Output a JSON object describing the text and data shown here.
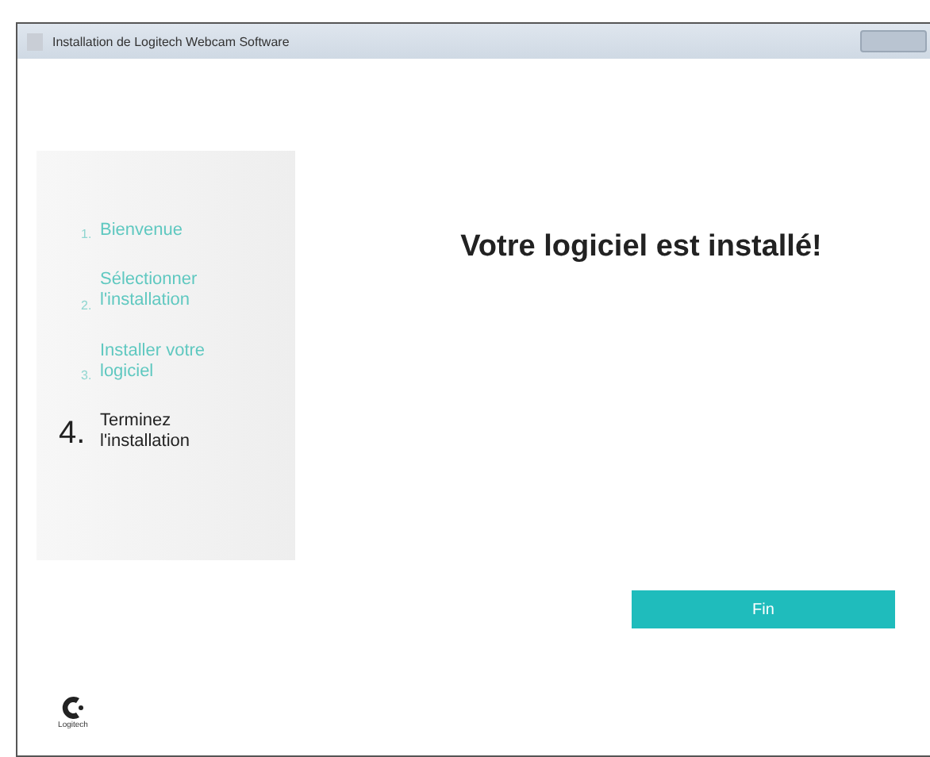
{
  "window": {
    "title": "Installation de Logitech Webcam Software"
  },
  "steps": [
    {
      "number": "1.",
      "label": "Bienvenue",
      "selected": false
    },
    {
      "number": "2.",
      "label": "Sélectionner l'installation",
      "selected": false
    },
    {
      "number": "3.",
      "label": "Installer votre logiciel",
      "selected": false
    },
    {
      "number": "4.",
      "label": "Terminez l'installation",
      "selected": true
    }
  ],
  "heading": "Votre logiciel est installé!",
  "finish_button": "Fin",
  "logo": {
    "text": "Logitech"
  }
}
